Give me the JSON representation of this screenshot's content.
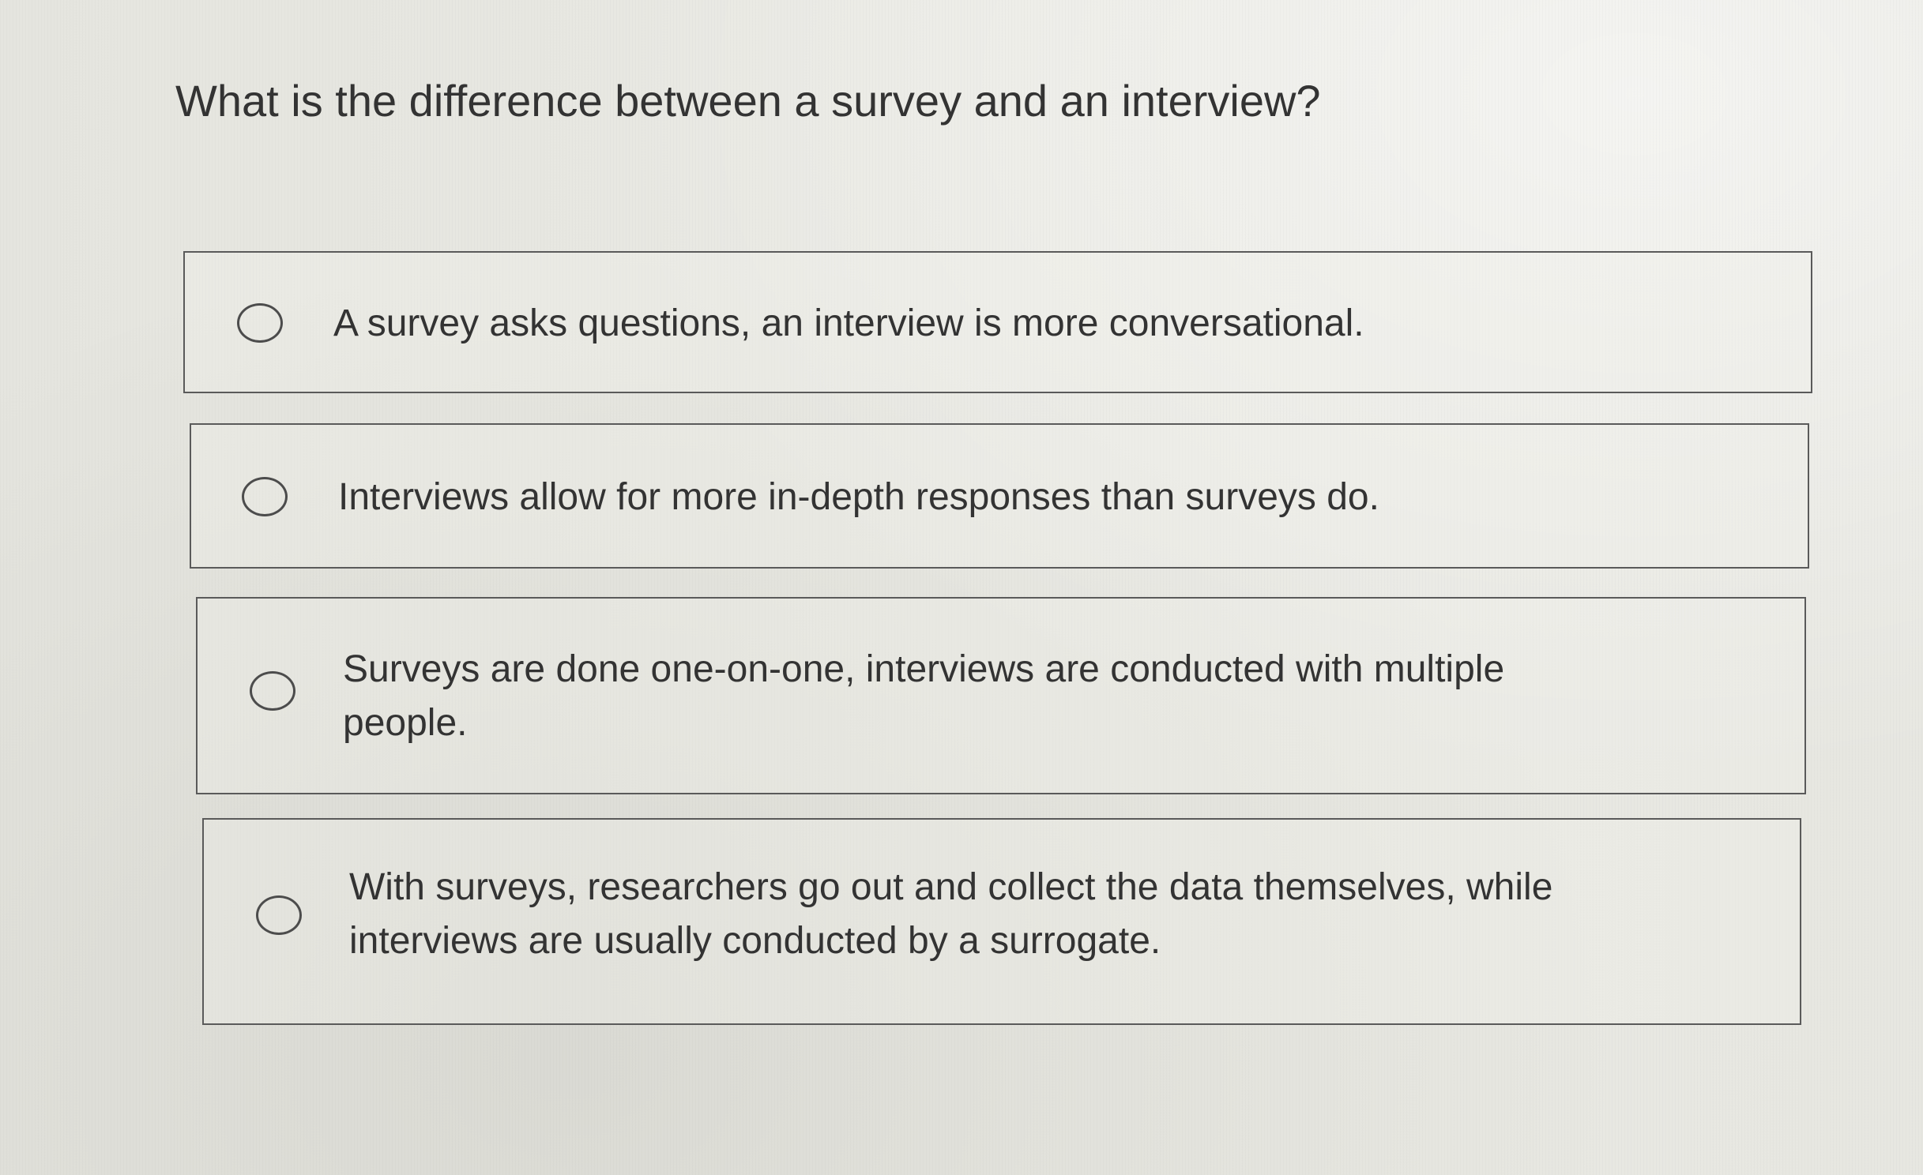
{
  "question": {
    "text": "What is the difference between a survey and an interview?"
  },
  "options": [
    {
      "label": "A survey asks questions, an interview is more conversational.",
      "selected": false
    },
    {
      "label": "Interviews allow for more in-depth responses than surveys do.",
      "selected": false
    },
    {
      "label": "Surveys are done one-on-one, interviews are conducted with multiple people.",
      "selected": false
    },
    {
      "label": "With surveys, researchers go out and collect the data themselves, while interviews are usually conducted by a surrogate.",
      "selected": false
    }
  ],
  "icons": {
    "radio": "radio-button-unselected-icon"
  }
}
